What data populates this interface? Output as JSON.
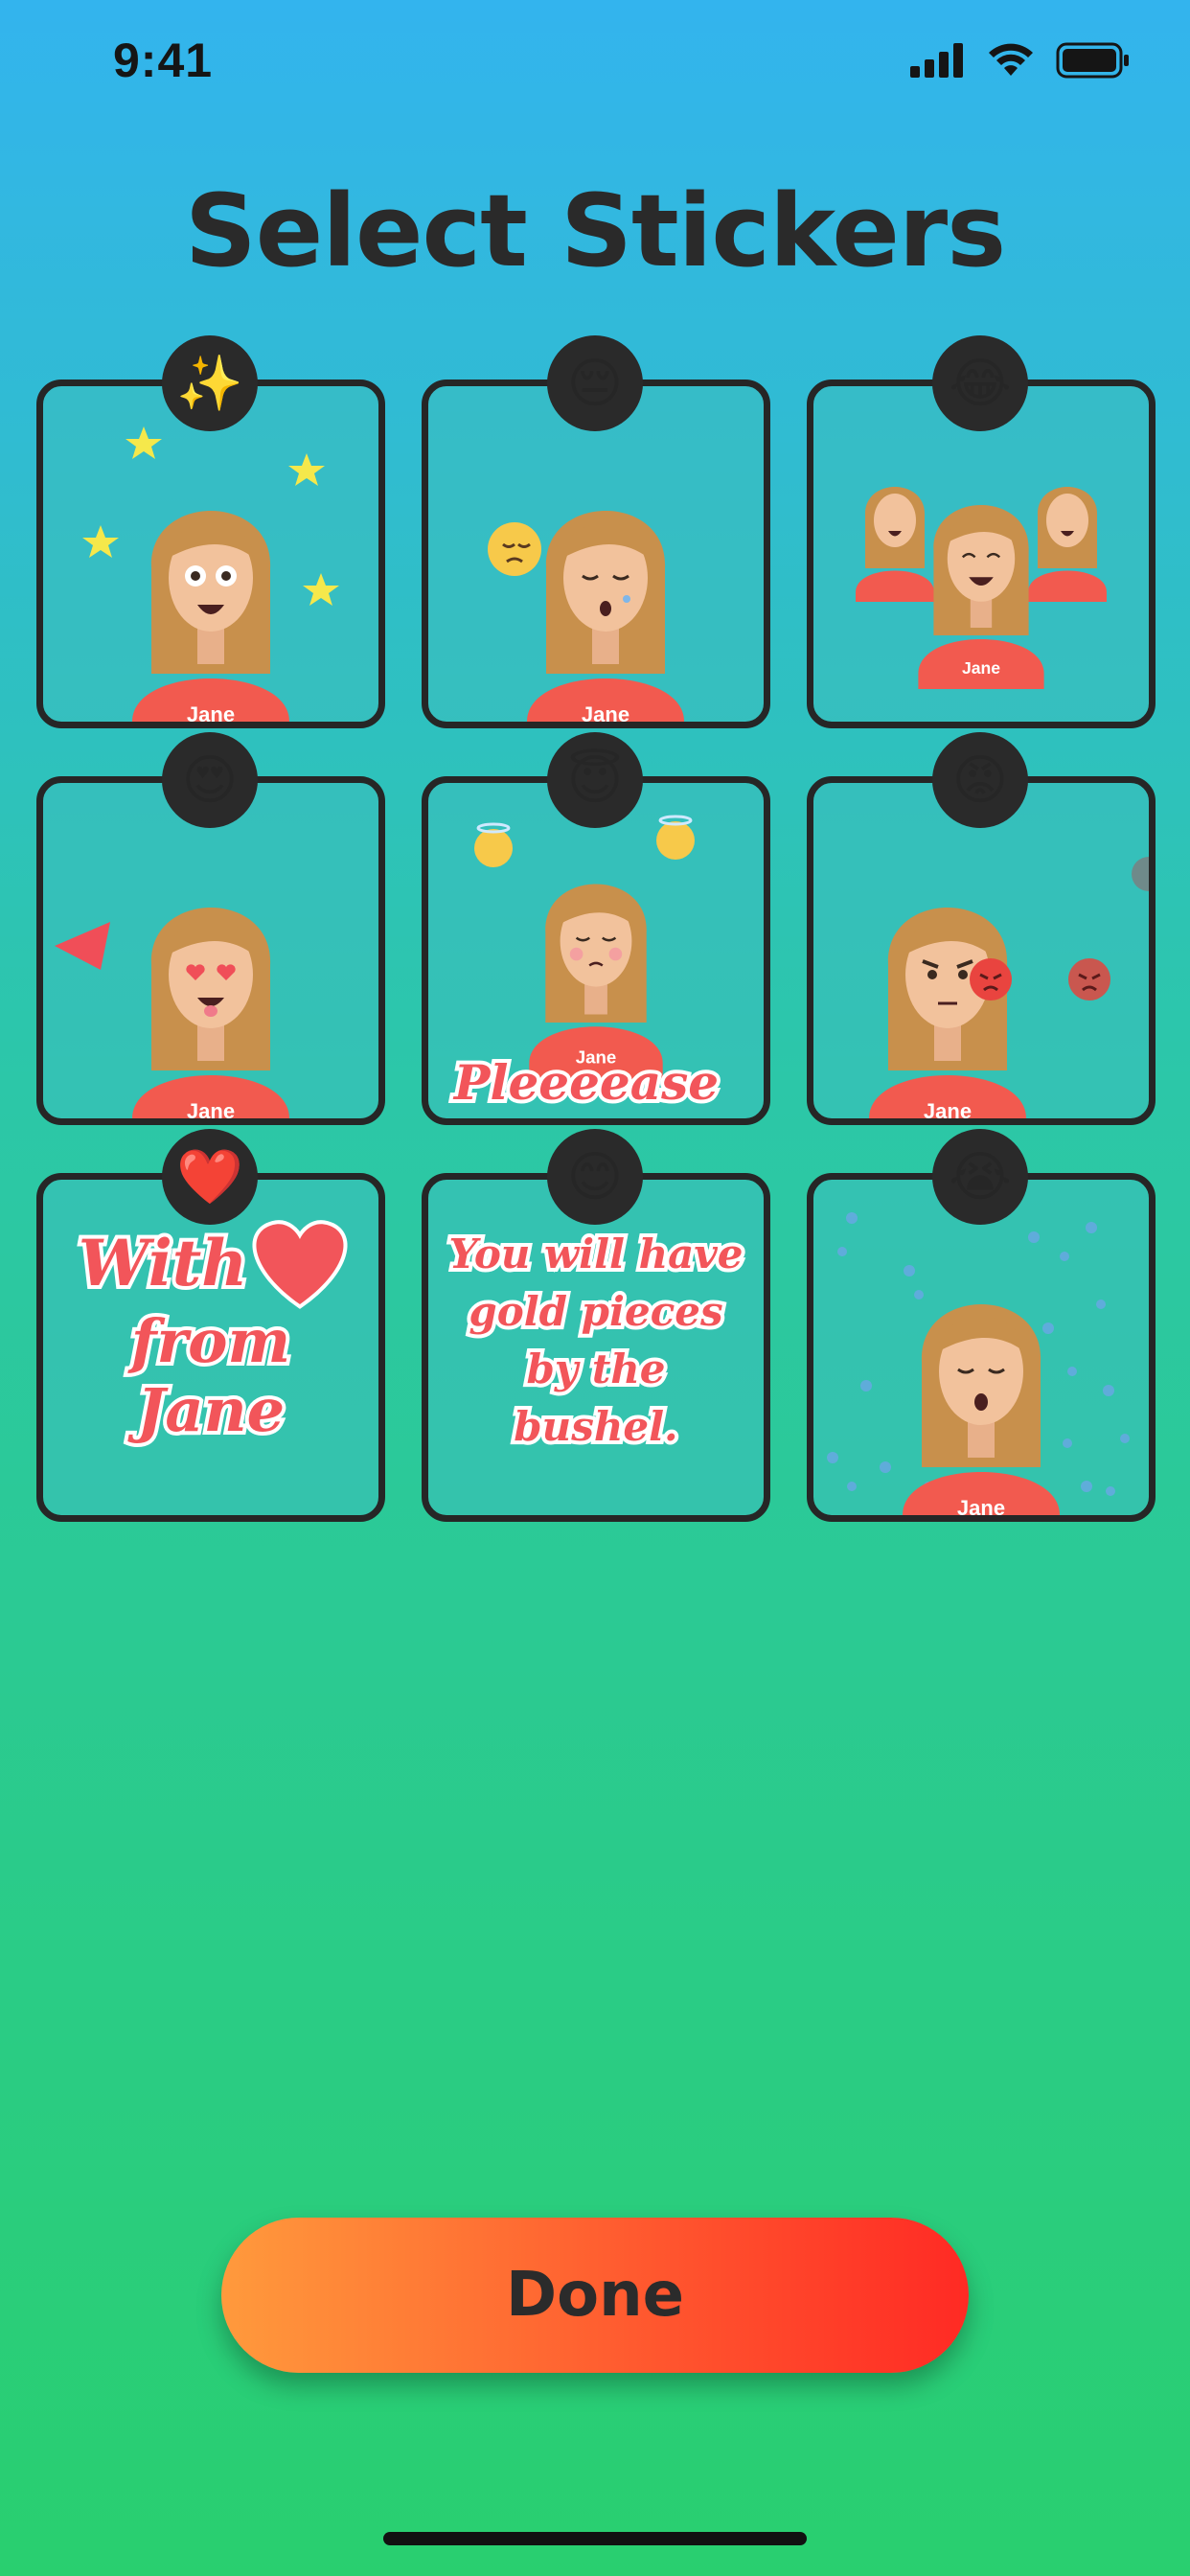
{
  "status_bar": {
    "time": "9:41"
  },
  "title": "Select Stickers",
  "stickers": [
    {
      "badge_emoji": "✨",
      "name": "Jane"
    },
    {
      "badge_emoji": "😔",
      "name": "Jane"
    },
    {
      "badge_emoji": "😂",
      "name": "Jane"
    },
    {
      "badge_emoji": "😍",
      "name": "Jane"
    },
    {
      "badge_emoji": "😇",
      "name": "Jane",
      "caption": "Pleeeease"
    },
    {
      "badge_emoji": "😡",
      "name": "Jane"
    },
    {
      "badge_emoji": "❤️",
      "lines": [
        "With",
        "from",
        "Jane"
      ]
    },
    {
      "badge_emoji": "😊",
      "lines": [
        "You will have",
        "gold pieces",
        "by the",
        "bushel."
      ]
    },
    {
      "badge_emoji": "😭",
      "name": "Jane"
    }
  ],
  "done_button": {
    "label": "Done"
  },
  "colors": {
    "accent_orange": "#ff9a3c",
    "accent_red": "#ff2a24",
    "sticker_red": "#f2555a"
  }
}
